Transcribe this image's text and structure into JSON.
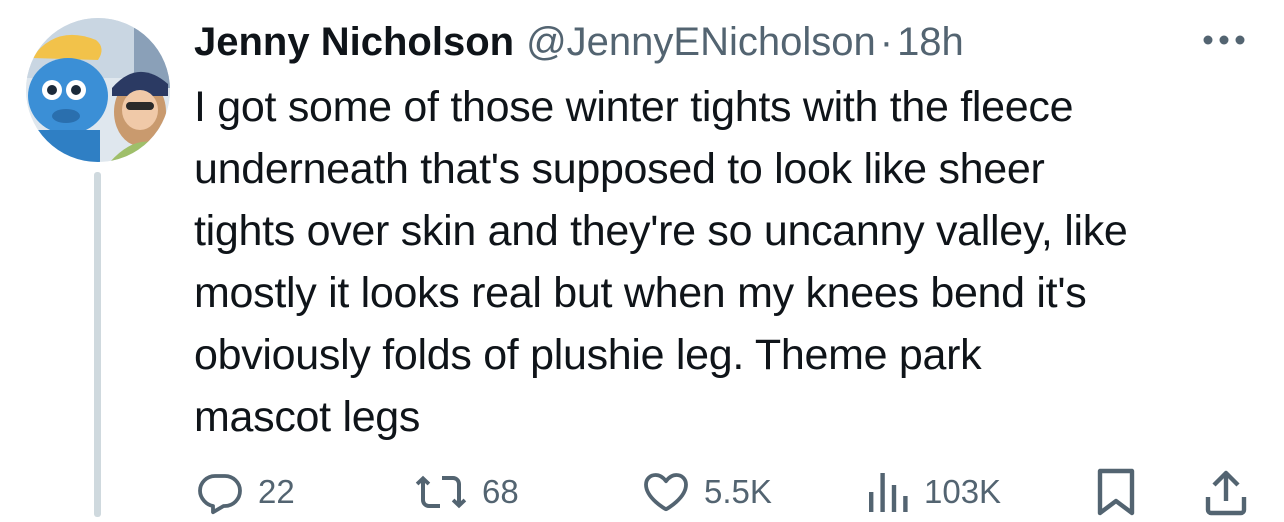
{
  "tweet": {
    "author_name": "Jenny Nicholson",
    "handle": "@JennyENicholson",
    "separator": "·",
    "time": "18h",
    "text": "I got some of those winter tights with the fleece\nunderneath that's supposed to look like sheer\ntights over skin and they're so uncanny valley, like\nmostly it looks real but when my knees bend it's\nobviously folds of plushie leg. Theme park\nmascot legs"
  },
  "actions": {
    "replies": "22",
    "reposts": "68",
    "likes": "5.5K",
    "views": "103K"
  },
  "icons": {
    "more": "more-horizontal-icon",
    "reply": "reply-icon",
    "repost": "repost-icon",
    "like": "heart-icon",
    "views": "views-icon",
    "bookmark": "bookmark-icon",
    "share": "share-icon"
  },
  "colors": {
    "text_primary": "#0f1419",
    "text_secondary": "#536471",
    "thread_line": "#cfd9de"
  }
}
